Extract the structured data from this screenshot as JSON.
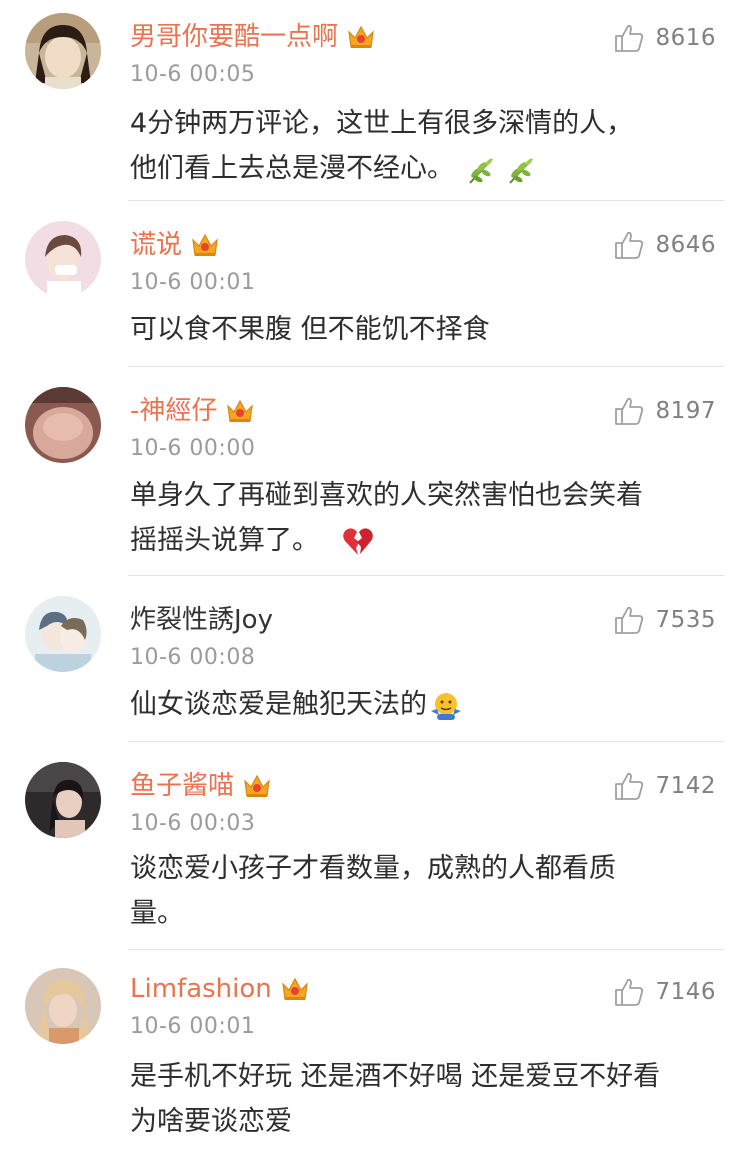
{
  "comments": [
    {
      "username": "男哥你要酷一点啊",
      "time": "10-6 00:05",
      "likes": "8616",
      "lines": [
        "4分钟两万评论，这世上有很多深情的人，",
        "他们看上去总是漫不经心。"
      ],
      "emoji_icons": [
        "herb-icon",
        "herb-icon"
      ]
    },
    {
      "username": "谎说",
      "time": "10-6 00:01",
      "likes": "8646",
      "lines": [
        "可以食不果腹 但不能饥不择食"
      ]
    },
    {
      "username": "-神經仔",
      "time": "10-6 00:00",
      "likes": "8197",
      "lines": [
        "单身久了再碰到喜欢的人突然害怕也会笑着",
        "摇摇头说算了。"
      ],
      "emoji_icons": [
        "broken-heart-icon"
      ]
    },
    {
      "username": "炸裂性誘Joy",
      "time": "10-6 00:08",
      "likes": "7535",
      "lines": [
        "仙女谈恋爱是触犯天法的"
      ],
      "emoji_icons": [
        "shrug-emoji-icon"
      ]
    },
    {
      "username": "鱼子酱喵",
      "time": "10-6 00:03",
      "likes": "7142",
      "lines": [
        "谈恋爱小孩子才看数量，成熟的人都看质",
        "量。"
      ]
    },
    {
      "username": "Limfashion",
      "time": "10-6 00:01",
      "likes": "7146",
      "lines": [
        "是手机不好玩 还是酒不好喝 还是爱豆不好看",
        "为啥要谈恋爱"
      ]
    }
  ],
  "colors": {
    "vip_name": "#eb7350",
    "crown": "#f5a623",
    "timestamp": "#9b9b9b",
    "like": "#808080",
    "divider": "#e4e4e4"
  }
}
